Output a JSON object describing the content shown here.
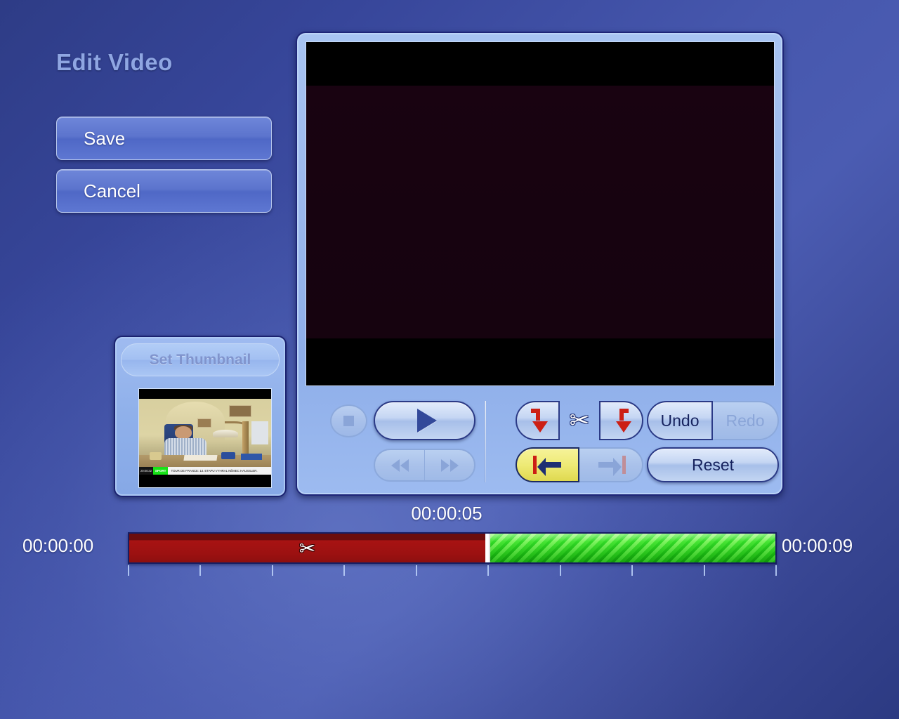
{
  "page": {
    "title": "Edit Video",
    "accent_blue": "#4657ad",
    "panel_blue": "#98b6ec",
    "trim_red": "#9c1111",
    "keep_green": "#49b93a",
    "mark_yellow": "#eeea76",
    "arrow_red": "#cc1f14"
  },
  "sidebar": {
    "buttons": [
      {
        "label": "Save",
        "name": "save-button"
      },
      {
        "label": "Cancel",
        "name": "cancel-button"
      }
    ]
  },
  "thumbnail": {
    "set_thumbnail_label": "Set Thumbnail",
    "caption": {
      "time": "20:00:32",
      "tag": "SPORT",
      "text": "TOUR DE FRANCE: 13. ETAPU VYHRAL NĚMEC HAUSSLER."
    }
  },
  "transport": {
    "stop_icon": "stop-icon",
    "play_icon": "play-icon",
    "rewind_icon": "rewind-icon",
    "forward_icon": "fast-forward-icon",
    "cut_start_icon": "cut-start-arrow-icon",
    "scissors_icon": "scissors-icon",
    "scissors_glyph": "✂",
    "cut_end_icon": "cut-end-arrow-icon",
    "mark_in_icon": "mark-in-icon",
    "mark_out_icon": "mark-out-icon",
    "undo_label": "Undo",
    "redo_label": "Redo",
    "reset_label": "Reset"
  },
  "timeline": {
    "start_label": "00:00:00",
    "current_label": "00:00:05",
    "end_label": "00:00:09",
    "scissors_glyph": "✂",
    "trimmed_seconds": 5,
    "total_seconds": 9,
    "tick_count": 10
  }
}
